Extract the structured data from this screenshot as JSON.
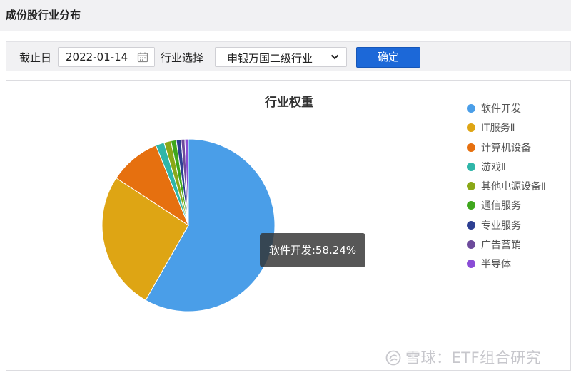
{
  "page": {
    "title": "成份股行业分布"
  },
  "filters": {
    "date_label": "截止日",
    "date_value": "2022-01-14",
    "industry_label": "行业选择",
    "industry_value": "申银万国二级行业",
    "confirm_label": "确定"
  },
  "chart_data": {
    "type": "pie",
    "title": "行业权重",
    "slices": [
      {
        "label": "软件开发",
        "value": 58.24,
        "color": "#4a9ee8"
      },
      {
        "label": "IT服务Ⅱ",
        "value": 26.0,
        "color": "#dea514"
      },
      {
        "label": "计算机设备",
        "value": 9.6,
        "color": "#e6700f"
      },
      {
        "label": "游戏Ⅱ",
        "value": 1.6,
        "color": "#2fb6a9"
      },
      {
        "label": "其他电源设备Ⅱ",
        "value": 1.3,
        "color": "#8aa817"
      },
      {
        "label": "通信服务",
        "value": 1.0,
        "color": "#3fa71d"
      },
      {
        "label": "专业服务",
        "value": 0.9,
        "color": "#2d3f92"
      },
      {
        "label": "广告营销",
        "value": 0.7,
        "color": "#6d4b9c"
      },
      {
        "label": "半导体",
        "value": 0.66,
        "color": "#8a4cd6"
      }
    ],
    "legend_position": "right",
    "tooltip": "软件开发:58.24%"
  },
  "watermark": {
    "text": "雪球：ETF组合研究"
  }
}
